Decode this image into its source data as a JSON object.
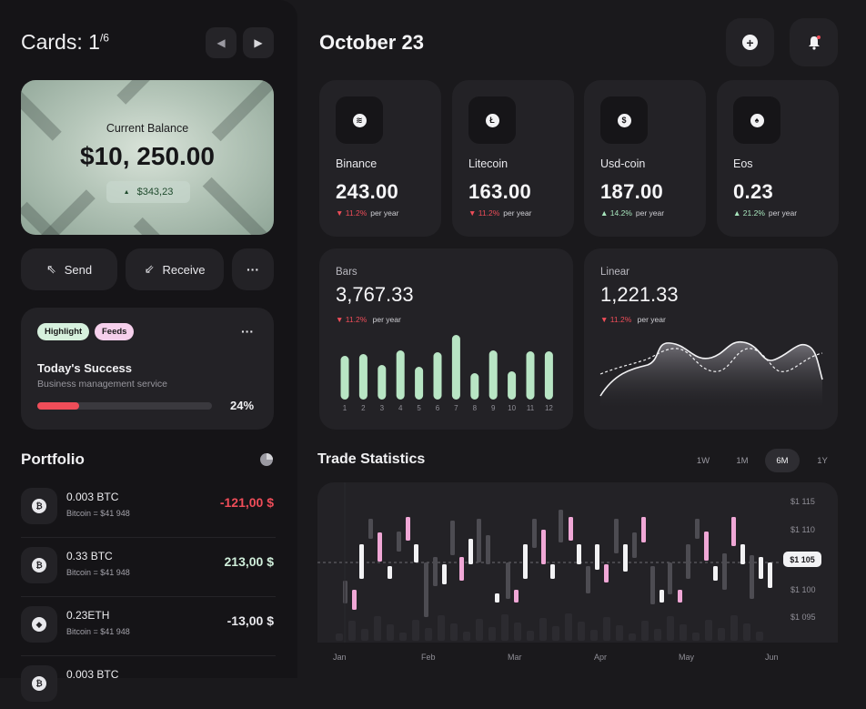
{
  "cards": {
    "title": "Cards: 1",
    "fraction": "/6",
    "prev_icon": "chevron-left-icon",
    "next_icon": "chevron-right-icon"
  },
  "balance_card": {
    "label": "Current Balance",
    "amount": "$10, 250.00",
    "change": "$343,23"
  },
  "actions": {
    "send": "Send",
    "receive": "Receive",
    "more": "···"
  },
  "highlight_card": {
    "tags": [
      "Highlight",
      "Feeds"
    ],
    "more": "···",
    "title": "Today's Success",
    "subtitle": "Business management service",
    "progress_percent": "24%",
    "progress": 0.24
  },
  "portfolio": {
    "title": "Portfolio",
    "items": [
      {
        "amount": "0.003 BTC",
        "sub": "Bitcoin = $41 948",
        "value": "-121,00 $",
        "trend": "down"
      },
      {
        "amount": "0.33 BTC",
        "sub": "Bitcoin = $41 948",
        "value": "213,00 $",
        "trend": "up"
      },
      {
        "amount": "0.23ETH",
        "sub": "Bitcoin = $41 948",
        "value": "-13,00 $",
        "trend": "neutral"
      },
      {
        "amount": "0.003 BTC",
        "sub": "",
        "value": "",
        "trend": "neutral"
      }
    ]
  },
  "header": {
    "date": "October 23",
    "add_icon": "plus-icon",
    "notification_icon": "bell-icon"
  },
  "stats": [
    {
      "name": "Binance",
      "value": "243.00",
      "change": "11.2%",
      "period": "per year",
      "trend": "down",
      "icon": "binance-icon"
    },
    {
      "name": "Litecoin",
      "value": "163.00",
      "change": "11.2%",
      "period": "per year",
      "trend": "down",
      "icon": "litecoin-icon"
    },
    {
      "name": "Usd-coin",
      "value": "187.00",
      "change": "14.2%",
      "period": "per year",
      "trend": "up",
      "icon": "usd-coin-icon"
    },
    {
      "name": "Eos",
      "value": "0.23",
      "change": "21.2%",
      "period": "per year",
      "trend": "up",
      "icon": "eos-icon"
    }
  ],
  "bars_card": {
    "title": "Bars",
    "value": "3,767.33",
    "change": "11.2%",
    "period": "per year",
    "labels": [
      "1",
      "2",
      "3",
      "4",
      "5",
      "6",
      "7",
      "8",
      "9",
      "10",
      "11",
      "12"
    ],
    "values": [
      48,
      50,
      38,
      54,
      36,
      52,
      71,
      29,
      54,
      31,
      53,
      53
    ]
  },
  "linear_card": {
    "title": "Linear",
    "value": "1,221.33",
    "change": "11.2%",
    "period": "per year"
  },
  "trade": {
    "title": "Trade Statistics",
    "periods": [
      "1W",
      "1M",
      "6M",
      "1Y"
    ],
    "active_period": "6M",
    "y_labels": [
      "$1 115",
      "$1 110",
      "$1 105",
      "$1 100",
      "$1 095"
    ],
    "current_price": "$1 105",
    "x_labels": [
      "Jan",
      "Feb",
      "Mar",
      "Apr",
      "May",
      "Jun"
    ]
  },
  "colors": {
    "accent_green": "#b8e5c4",
    "accent_pink": "#f0a7d6",
    "negative": "#ef4d59",
    "positive": "#b8e5c4"
  }
}
